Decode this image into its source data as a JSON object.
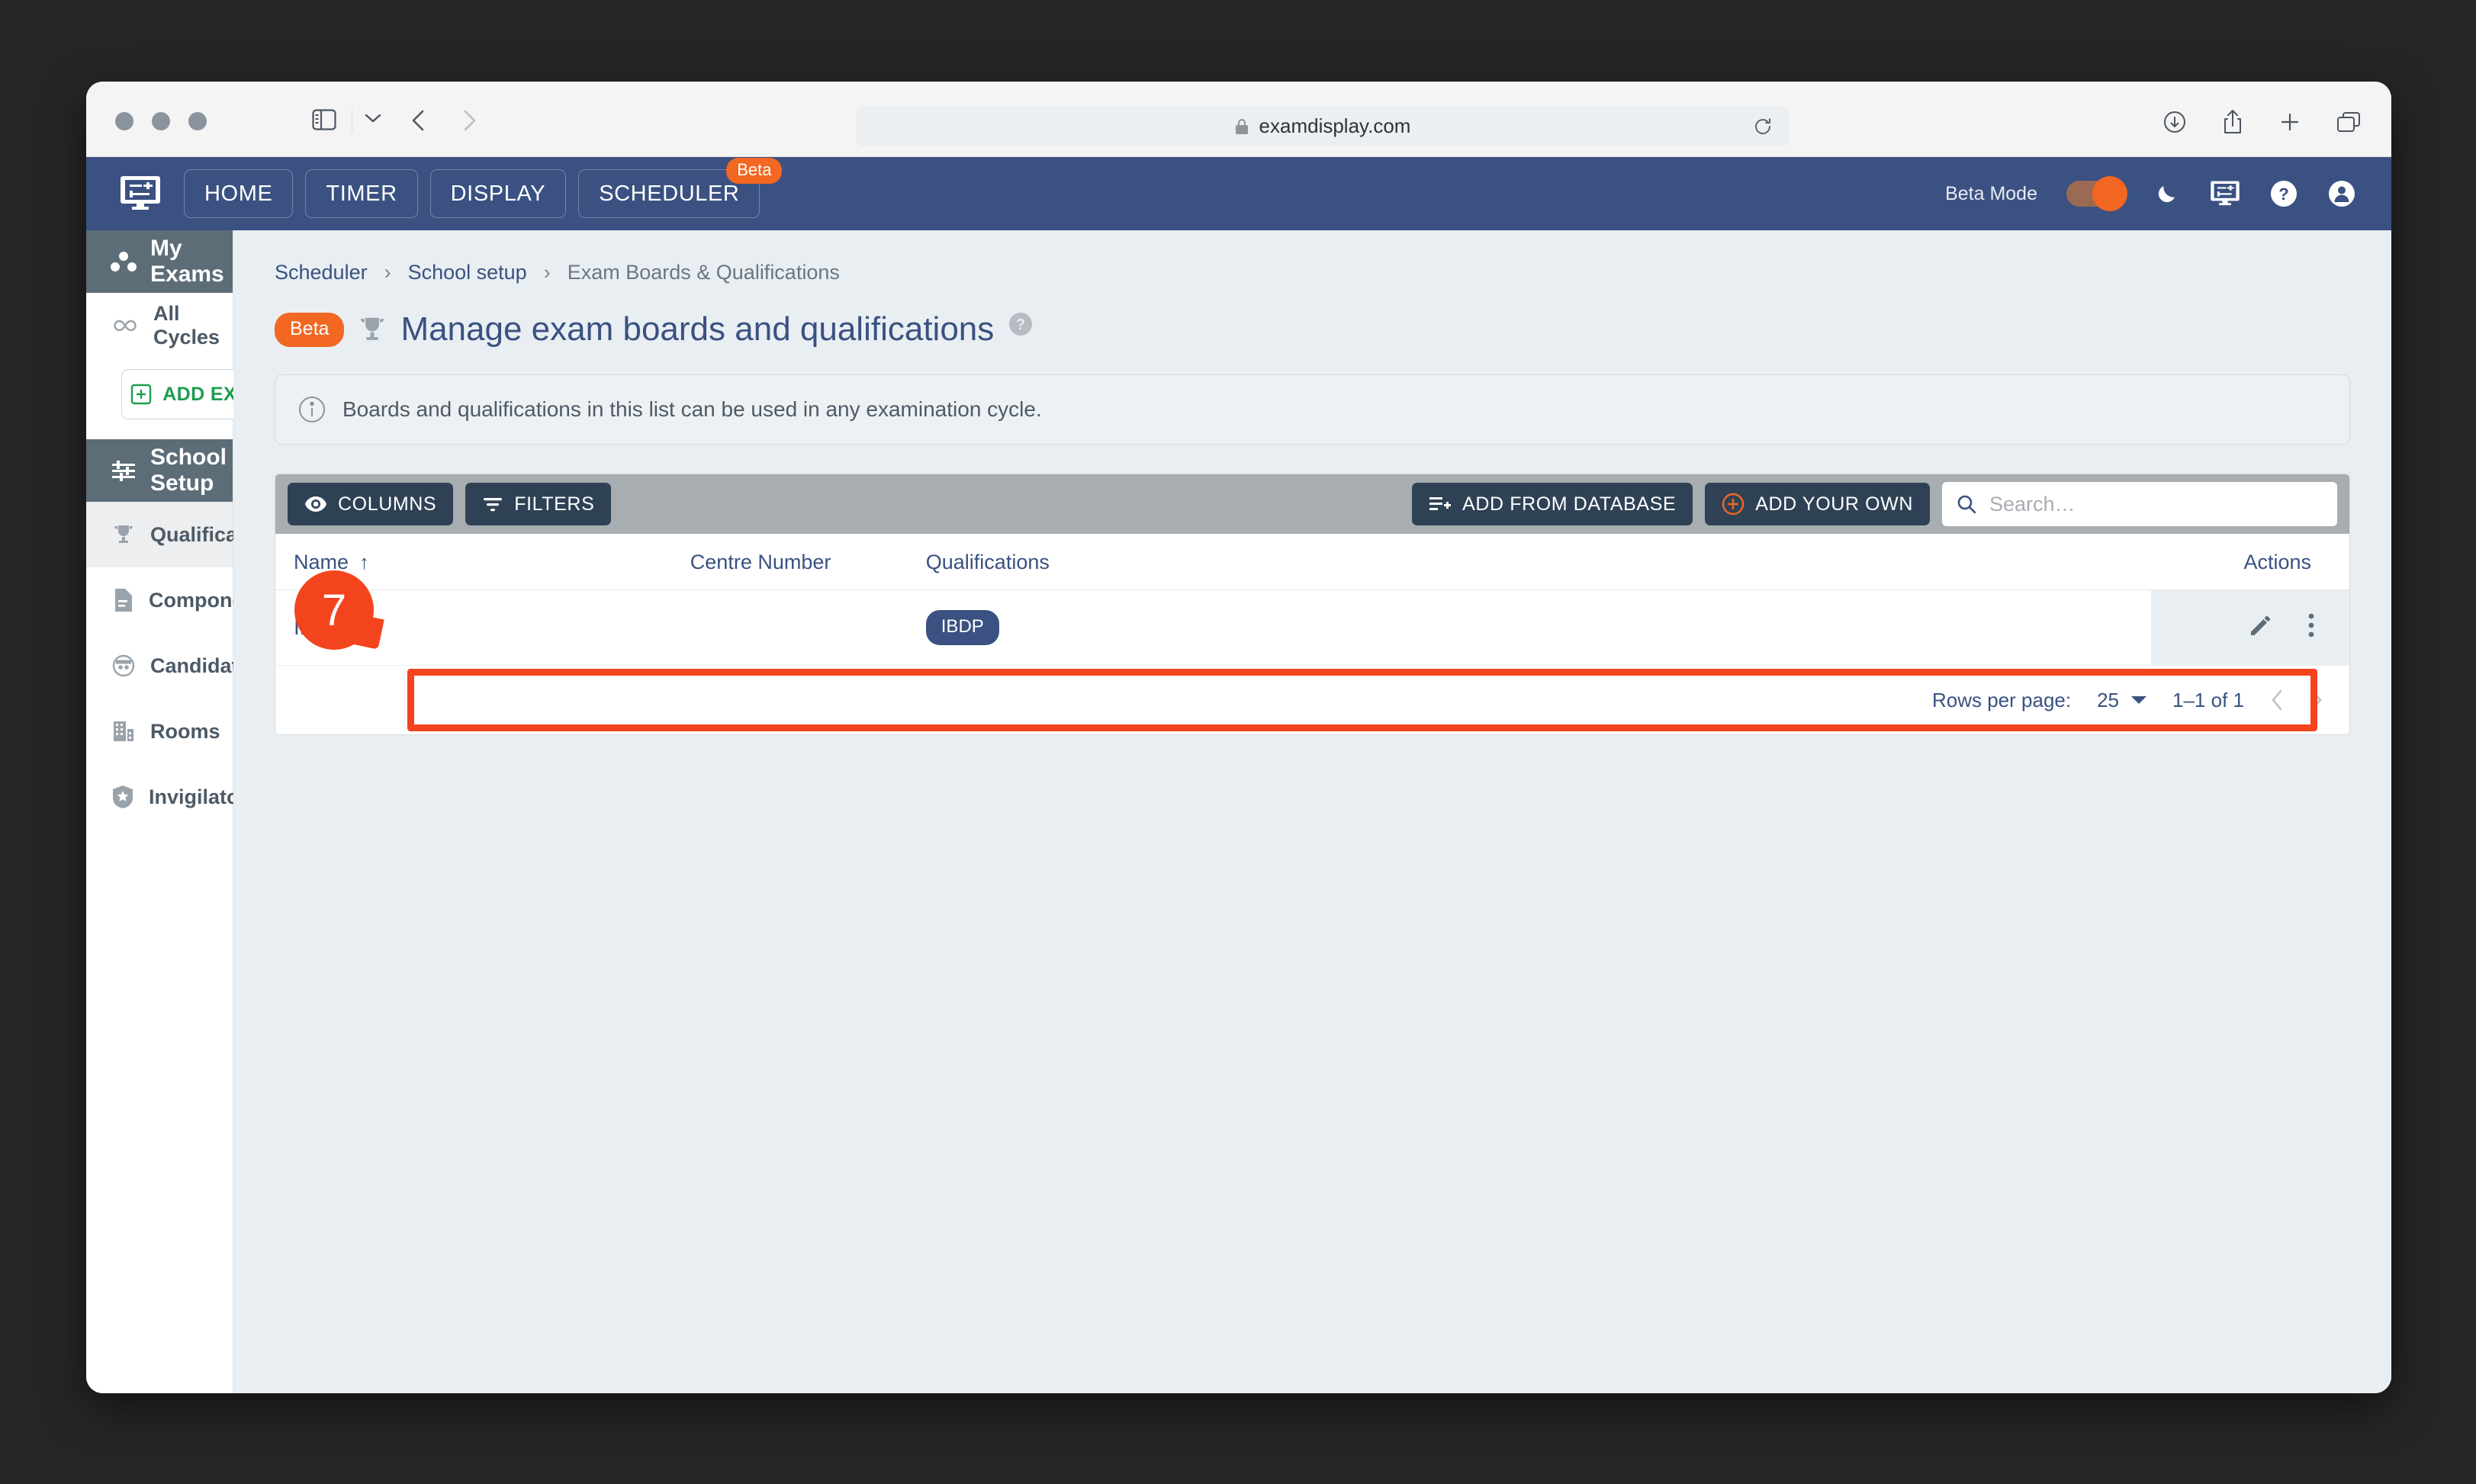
{
  "browser": {
    "url": "examdisplay.com",
    "lock_icon": "lock-icon",
    "reload_icon": "reload-icon",
    "back_icon": "back-chevron-icon",
    "forward_icon": "forward-chevron-icon",
    "sidebar_icon": "sidebar-toggle-icon",
    "downloads_icon": "downloads-icon",
    "share_icon": "share-icon",
    "newtab_icon": "plus-icon",
    "tabs_icon": "tab-overview-icon"
  },
  "topnav": {
    "logo_icon": "display-settings-icon",
    "items": [
      {
        "label": "HOME",
        "badge": null
      },
      {
        "label": "TIMER",
        "badge": null
      },
      {
        "label": "DISPLAY",
        "badge": null
      },
      {
        "label": "SCHEDULER",
        "badge": "Beta"
      }
    ],
    "beta_mode_label": "Beta Mode",
    "beta_mode_on": true,
    "icons": [
      "moon-icon",
      "display-settings-icon",
      "help-icon",
      "account-icon"
    ],
    "bg_color": "#3a5181",
    "accent_color": "#f26722"
  },
  "sidebar": {
    "sections": [
      {
        "label": "My Exams",
        "icon": "group-dots-icon",
        "items": [
          {
            "label": "All Cycles",
            "icon": "infinity-icon",
            "active": false
          }
        ],
        "button": {
          "label": "ADD EXAM CYCLE",
          "icon": "plus-box-icon",
          "color": "#1f9d4e"
        }
      },
      {
        "label": "School Setup",
        "icon": "tune-icon",
        "items": [
          {
            "label": "Qualifications",
            "icon": "trophy-icon",
            "active": true
          },
          {
            "label": "Components",
            "icon": "document-icon",
            "active": false
          },
          {
            "label": "Candidates",
            "icon": "face-icon",
            "active": false
          },
          {
            "label": "Rooms",
            "icon": "building-icon",
            "active": false
          },
          {
            "label": "Invigilators",
            "icon": "shield-star-icon",
            "active": false
          }
        ]
      }
    ]
  },
  "breadcrumb": {
    "items": [
      "Scheduler",
      "School setup",
      "Exam Boards & Qualifications"
    ],
    "separator": "›"
  },
  "page": {
    "beta_label": "Beta",
    "title": "Manage exam boards and qualifications",
    "trophy_icon": "trophy-icon",
    "help_icon": "help-circle-icon",
    "info_text": "Boards and qualifications in this list can be used in any examination cycle.",
    "info_icon": "info-icon"
  },
  "toolbar": {
    "columns_label": "COLUMNS",
    "columns_icon": "eye-icon",
    "filters_label": "FILTERS",
    "filters_icon": "filter-icon",
    "add_from_database_label": "ADD FROM DATABASE",
    "add_from_database_icon": "playlist-add-icon",
    "add_your_own_label": "ADD YOUR OWN",
    "add_your_own_icon": "plus-circle-icon",
    "search_placeholder": "Search…",
    "search_value": "",
    "search_icon": "search-icon"
  },
  "table": {
    "columns": [
      {
        "key": "name",
        "label": "Name",
        "sorted": "asc",
        "sort_glyph": "↑"
      },
      {
        "key": "centre",
        "label": "Centre Number"
      },
      {
        "key": "quals",
        "label": "Qualifications"
      },
      {
        "key": "actions",
        "label": "Actions"
      }
    ],
    "rows": [
      {
        "name": "IBO",
        "centre": "",
        "quals": [
          "IBDP"
        ]
      }
    ],
    "row_actions": [
      "edit-pencil-icon",
      "more-vertical-icon"
    ],
    "chip_color": "#3a5181"
  },
  "pagination": {
    "rows_per_page_label": "Rows per page:",
    "rows_per_page_value": "25",
    "range_label": "1–1 of 1",
    "prev_icon": "chevron-left-icon",
    "next_icon": "chevron-right-icon"
  },
  "annotation": {
    "step_number": "7",
    "color": "#f4441e"
  }
}
